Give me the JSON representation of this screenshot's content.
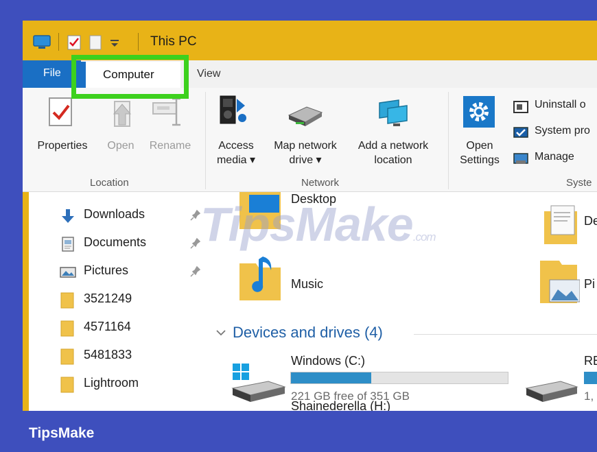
{
  "window": {
    "title": "This PC"
  },
  "tabs": [
    {
      "label": "File"
    },
    {
      "label": "Computer"
    },
    {
      "label": "View"
    }
  ],
  "ribbon": {
    "location": {
      "group_label": "Location",
      "buttons": [
        {
          "label": "Properties"
        },
        {
          "label": "Open"
        },
        {
          "label": "Rename"
        }
      ]
    },
    "network": {
      "group_label": "Network",
      "buttons": [
        {
          "line1": "Access",
          "line2": "media ▾"
        },
        {
          "line1": "Map network",
          "line2": "drive ▾"
        },
        {
          "line1": "Add a network",
          "line2": "location"
        }
      ]
    },
    "system": {
      "group_label": "Syste",
      "open_settings": {
        "line1": "Open",
        "line2": "Settings"
      },
      "items": [
        {
          "label": "Uninstall o",
          "icon": "uninstall-icon"
        },
        {
          "label": "System pro",
          "icon": "system-properties-icon"
        },
        {
          "label": "Manage",
          "icon": "manage-icon"
        }
      ]
    }
  },
  "nav": {
    "items": [
      {
        "label": "Downloads",
        "icon": "download-arrow-icon",
        "pinned": true
      },
      {
        "label": "Documents",
        "icon": "document-icon",
        "pinned": true
      },
      {
        "label": "Pictures",
        "icon": "pictures-icon",
        "pinned": true
      },
      {
        "label": "3521249",
        "icon": "folder-icon",
        "pinned": false
      },
      {
        "label": "4571164",
        "icon": "folder-icon",
        "pinned": false
      },
      {
        "label": "5481833",
        "icon": "folder-icon",
        "pinned": false
      },
      {
        "label": "Lightroom",
        "icon": "folder-icon",
        "pinned": false
      }
    ]
  },
  "folders": [
    {
      "label": "Desktop"
    },
    {
      "label": "Music"
    },
    {
      "label": "De"
    },
    {
      "label": "Pi"
    }
  ],
  "devices": {
    "header": "Devices and drives (4)",
    "drives": [
      {
        "label": "Windows (C:)",
        "free_text": "221 GB free of 351 GB",
        "used_fraction": 0.37
      },
      {
        "label": "RE",
        "free_text": "1,",
        "used_fraction": 0.5
      },
      {
        "label": "Shainederella (H:)"
      }
    ]
  },
  "watermark": {
    "text": "TipsMake",
    "suffix": ".com"
  },
  "footer": {
    "brand": "TipsMake"
  },
  "colors": {
    "titlebar": "#e8b317",
    "accent": "#1a6fc4",
    "highlight": "#3dd11e",
    "footer": "#3e4fbd"
  }
}
